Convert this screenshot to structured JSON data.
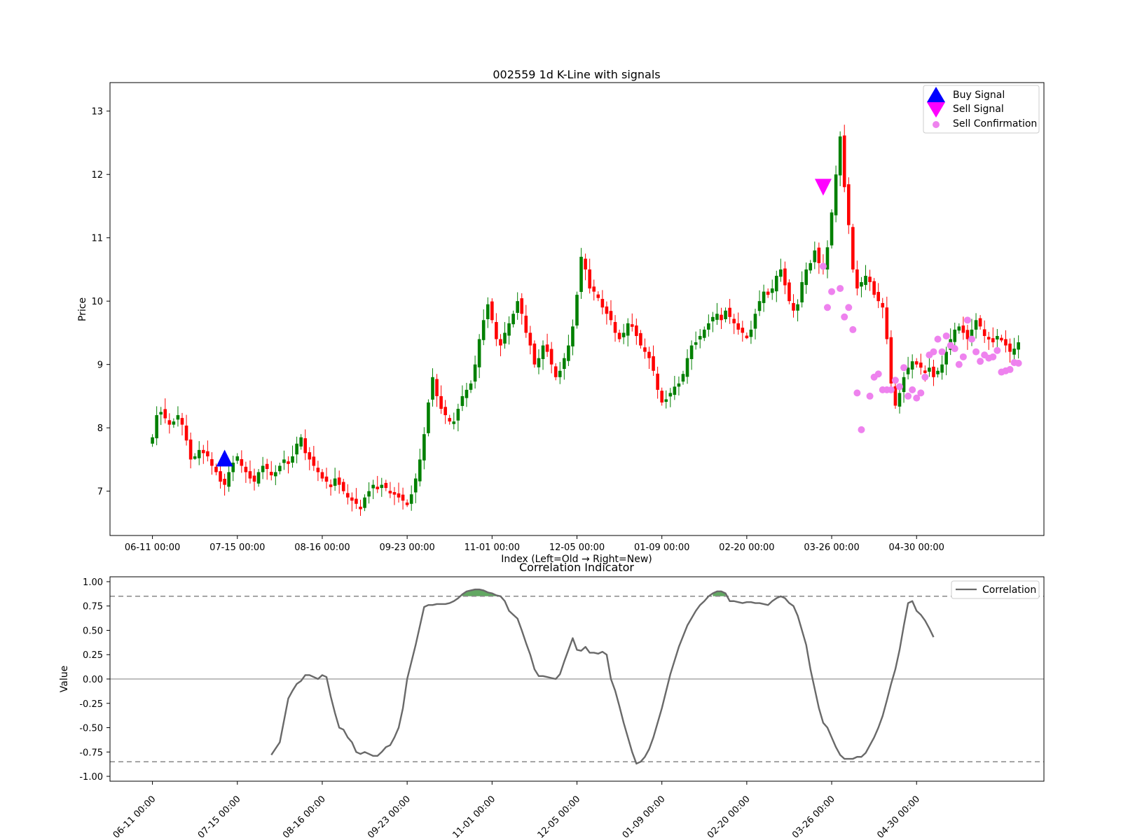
{
  "chart_data": [
    {
      "type": "candlestick",
      "title": "002559 1d K-Line with signals",
      "xlabel": "Index (Left=Old → Right=New)",
      "ylabel": "Price",
      "ylim": [
        6.3,
        13.45
      ],
      "xlim": [
        -10,
        210
      ],
      "x_ticks": [
        {
          "x": 0,
          "label": "06-11 00:00"
        },
        {
          "x": 20,
          "label": "07-15 00:00"
        },
        {
          "x": 40,
          "label": "08-16 00:00"
        },
        {
          "x": 60,
          "label": "09-23 00:00"
        },
        {
          "x": 80,
          "label": "11-01 00:00"
        },
        {
          "x": 100,
          "label": "12-05 00:00"
        },
        {
          "x": 120,
          "label": "01-09 00:00"
        },
        {
          "x": 140,
          "label": "02-20 00:00"
        },
        {
          "x": 160,
          "label": "03-26 00:00"
        },
        {
          "x": 180,
          "label": "04-30 00:00"
        }
      ],
      "y_ticks": [
        7,
        8,
        9,
        10,
        11,
        12,
        13
      ],
      "colors": {
        "up": "#008000",
        "down": "#ff0000",
        "buy": "#0000ff",
        "sell": "#ff00ff",
        "confirm": "#ee82ee"
      },
      "legend": {
        "position": "top-right",
        "entries": [
          {
            "label": "Buy Signal",
            "marker": "triangle-up",
            "color": "#0000ff"
          },
          {
            "label": "Sell Signal",
            "marker": "triangle-down",
            "color": "#ff00ff"
          },
          {
            "label": "Sell Confirmation",
            "marker": "circle",
            "color": "#ee82ee"
          }
        ]
      },
      "closes": [
        7.85,
        8.2,
        8.25,
        8.15,
        8.05,
        8.1,
        8.2,
        8.05,
        7.8,
        7.5,
        7.55,
        7.65,
        7.6,
        7.55,
        7.4,
        7.3,
        7.15,
        7.1,
        7.3,
        7.45,
        7.55,
        7.4,
        7.3,
        7.2,
        7.15,
        7.3,
        7.4,
        7.35,
        7.25,
        7.3,
        7.4,
        7.5,
        7.45,
        7.55,
        7.75,
        7.85,
        7.6,
        7.5,
        7.4,
        7.3,
        7.2,
        7.15,
        7.1,
        7.2,
        7.1,
        7.0,
        6.9,
        6.85,
        6.8,
        6.75,
        6.9,
        7.0,
        7.1,
        7.05,
        7.1,
        7.05,
        7.0,
        6.95,
        6.9,
        6.85,
        6.8,
        6.95,
        7.2,
        7.5,
        7.9,
        8.4,
        8.8,
        8.5,
        8.3,
        8.2,
        8.1,
        8.1,
        8.3,
        8.5,
        8.6,
        8.7,
        9.0,
        9.4,
        9.7,
        9.95,
        9.7,
        9.4,
        9.3,
        9.5,
        9.65,
        9.8,
        10.0,
        9.8,
        9.5,
        9.3,
        9.0,
        9.1,
        9.3,
        9.2,
        9.0,
        8.8,
        8.9,
        9.1,
        9.3,
        9.6,
        10.1,
        10.7,
        10.5,
        10.2,
        10.15,
        10.05,
        9.9,
        9.8,
        9.7,
        9.5,
        9.4,
        9.5,
        9.65,
        9.6,
        9.45,
        9.3,
        9.2,
        9.1,
        8.9,
        8.6,
        8.4,
        8.45,
        8.55,
        8.65,
        8.7,
        8.85,
        9.1,
        9.3,
        9.35,
        9.45,
        9.55,
        9.65,
        9.75,
        9.8,
        9.7,
        9.85,
        9.75,
        9.65,
        9.55,
        9.5,
        9.45,
        9.55,
        9.8,
        10.0,
        10.15,
        10.1,
        10.2,
        10.4,
        10.5,
        10.25,
        10.0,
        9.85,
        9.95,
        10.3,
        10.5,
        10.6,
        10.8,
        10.6,
        10.5,
        10.85,
        11.4,
        12.0,
        12.6,
        11.8,
        11.2,
        10.5,
        10.2,
        10.3,
        10.4,
        10.3,
        10.1,
        10.0,
        9.9,
        9.4,
        8.7,
        8.35,
        8.55,
        8.8,
        8.95,
        9.05,
        9.0,
        8.95,
        8.9,
        8.95,
        8.8,
        8.9,
        9.0,
        9.2,
        9.4,
        9.55,
        9.6,
        9.5,
        9.4,
        9.55,
        9.7,
        9.6,
        9.45,
        9.4,
        9.35,
        9.45,
        9.4,
        9.3,
        9.2,
        9.25,
        9.35
      ],
      "signals": {
        "buy": [
          {
            "x": 17,
            "price": 7.5
          }
        ],
        "sell": [
          {
            "x": 158,
            "price": 11.82
          }
        ],
        "sell_confirmation": [
          {
            "x": 158,
            "price": 10.55
          },
          {
            "x": 159,
            "price": 9.9
          },
          {
            "x": 160,
            "price": 10.15
          },
          {
            "x": 162,
            "price": 10.2
          },
          {
            "x": 163,
            "price": 9.75
          },
          {
            "x": 164,
            "price": 9.9
          },
          {
            "x": 165,
            "price": 9.55
          },
          {
            "x": 166,
            "price": 8.55
          },
          {
            "x": 167,
            "price": 7.97
          },
          {
            "x": 169,
            "price": 8.5
          },
          {
            "x": 170,
            "price": 8.8
          },
          {
            "x": 171,
            "price": 8.85
          },
          {
            "x": 172,
            "price": 8.6
          },
          {
            "x": 173,
            "price": 8.6
          },
          {
            "x": 174,
            "price": 8.6
          },
          {
            "x": 175,
            "price": 8.75
          },
          {
            "x": 176,
            "price": 8.65
          },
          {
            "x": 177,
            "price": 8.95
          },
          {
            "x": 178,
            "price": 8.5
          },
          {
            "x": 179,
            "price": 8.6
          },
          {
            "x": 180,
            "price": 8.47
          },
          {
            "x": 181,
            "price": 8.55
          },
          {
            "x": 182,
            "price": 8.8
          },
          {
            "x": 183,
            "price": 9.15
          },
          {
            "x": 184,
            "price": 9.2
          },
          {
            "x": 185,
            "price": 9.4
          },
          {
            "x": 186,
            "price": 9.2
          },
          {
            "x": 187,
            "price": 9.45
          },
          {
            "x": 188,
            "price": 9.3
          },
          {
            "x": 189,
            "price": 9.25
          },
          {
            "x": 190,
            "price": 9.0
          },
          {
            "x": 191,
            "price": 9.12
          },
          {
            "x": 192,
            "price": 9.7
          },
          {
            "x": 193,
            "price": 9.4
          },
          {
            "x": 194,
            "price": 9.2
          },
          {
            "x": 195,
            "price": 9.05
          },
          {
            "x": 196,
            "price": 9.15
          },
          {
            "x": 197,
            "price": 9.1
          },
          {
            "x": 198,
            "price": 9.12
          },
          {
            "x": 199,
            "price": 9.22
          },
          {
            "x": 200,
            "price": 8.88
          },
          {
            "x": 201,
            "price": 8.9
          },
          {
            "x": 202,
            "price": 8.92
          },
          {
            "x": 203,
            "price": 9.03
          },
          {
            "x": 204,
            "price": 9.02
          }
        ]
      }
    },
    {
      "type": "line",
      "title": "Correlation Indicator",
      "ylabel": "Value",
      "ylim": [
        -1.05,
        1.05
      ],
      "xlim": [
        -10,
        210
      ],
      "y_ticks": [
        "1.00",
        "0.75",
        "0.50",
        "0.25",
        "0.00",
        "-0.25",
        "-0.50",
        "-0.75",
        "-1.00"
      ],
      "x_ticks": [
        {
          "x": 0,
          "label": "06-11 00:00"
        },
        {
          "x": 20,
          "label": "07-15 00:00"
        },
        {
          "x": 40,
          "label": "08-16 00:00"
        },
        {
          "x": 60,
          "label": "09-23 00:00"
        },
        {
          "x": 80,
          "label": "11-01 00:00"
        },
        {
          "x": 100,
          "label": "12-05 00:00"
        },
        {
          "x": 120,
          "label": "01-09 00:00"
        },
        {
          "x": 140,
          "label": "02-20 00:00"
        },
        {
          "x": 160,
          "label": "03-26 00:00"
        },
        {
          "x": 180,
          "label": "04-30 00:00"
        }
      ],
      "thresholds": [
        0.85,
        -0.85
      ],
      "grid": false,
      "legend": {
        "position": "top-right",
        "entries": [
          {
            "label": "Correlation",
            "color": "#696969"
          }
        ]
      },
      "series": [
        {
          "name": "Correlation",
          "color": "#696969",
          "points": [
            [
              28,
              -0.78
            ],
            [
              30,
              -0.65
            ],
            [
              32,
              -0.2
            ],
            [
              33,
              -0.12
            ],
            [
              34,
              -0.05
            ],
            [
              35,
              -0.02
            ],
            [
              36,
              0.04
            ],
            [
              37,
              0.04
            ],
            [
              38,
              0.02
            ],
            [
              39,
              0.0
            ],
            [
              40,
              0.04
            ],
            [
              41,
              0.02
            ],
            [
              42,
              -0.18
            ],
            [
              43,
              -0.35
            ],
            [
              44,
              -0.5
            ],
            [
              45,
              -0.52
            ],
            [
              46,
              -0.6
            ],
            [
              47,
              -0.65
            ],
            [
              48,
              -0.75
            ],
            [
              49,
              -0.77
            ],
            [
              50,
              -0.75
            ],
            [
              51,
              -0.77
            ],
            [
              52,
              -0.79
            ],
            [
              53,
              -0.79
            ],
            [
              54,
              -0.75
            ],
            [
              55,
              -0.7
            ],
            [
              56,
              -0.68
            ],
            [
              57,
              -0.6
            ],
            [
              58,
              -0.5
            ],
            [
              59,
              -0.3
            ],
            [
              60,
              0.0
            ],
            [
              62,
              0.35
            ],
            [
              64,
              0.74
            ],
            [
              65,
              0.76
            ],
            [
              66,
              0.76
            ],
            [
              67,
              0.77
            ],
            [
              68,
              0.77
            ],
            [
              69,
              0.77
            ],
            [
              70,
              0.78
            ],
            [
              71,
              0.8
            ],
            [
              72,
              0.83
            ],
            [
              73,
              0.87
            ],
            [
              74,
              0.9
            ],
            [
              75,
              0.91
            ],
            [
              76,
              0.92
            ],
            [
              77,
              0.92
            ],
            [
              78,
              0.91
            ],
            [
              79,
              0.89
            ],
            [
              80,
              0.88
            ],
            [
              81,
              0.86
            ],
            [
              82,
              0.85
            ],
            [
              83,
              0.8
            ],
            [
              84,
              0.7
            ],
            [
              85,
              0.66
            ],
            [
              86,
              0.62
            ],
            [
              87,
              0.5
            ],
            [
              88,
              0.37
            ],
            [
              89,
              0.25
            ],
            [
              90,
              0.1
            ],
            [
              91,
              0.03
            ],
            [
              92,
              0.03
            ],
            [
              93,
              0.02
            ],
            [
              94,
              0.01
            ],
            [
              95,
              0.0
            ],
            [
              96,
              0.05
            ],
            [
              97,
              0.18
            ],
            [
              98,
              0.3
            ],
            [
              99,
              0.42
            ],
            [
              100,
              0.3
            ],
            [
              101,
              0.29
            ],
            [
              102,
              0.33
            ],
            [
              103,
              0.27
            ],
            [
              104,
              0.27
            ],
            [
              105,
              0.26
            ],
            [
              106,
              0.28
            ],
            [
              107,
              0.25
            ],
            [
              108,
              0.0
            ],
            [
              109,
              -0.12
            ],
            [
              110,
              -0.28
            ],
            [
              111,
              -0.45
            ],
            [
              112,
              -0.6
            ],
            [
              113,
              -0.75
            ],
            [
              114,
              -0.87
            ],
            [
              115,
              -0.85
            ],
            [
              116,
              -0.8
            ],
            [
              117,
              -0.72
            ],
            [
              118,
              -0.6
            ],
            [
              120,
              -0.3
            ],
            [
              122,
              0.05
            ],
            [
              124,
              0.33
            ],
            [
              126,
              0.55
            ],
            [
              128,
              0.7
            ],
            [
              129,
              0.76
            ],
            [
              130,
              0.8
            ],
            [
              131,
              0.85
            ],
            [
              132,
              0.88
            ],
            [
              133,
              0.9
            ],
            [
              134,
              0.9
            ],
            [
              135,
              0.88
            ],
            [
              136,
              0.8
            ],
            [
              137,
              0.8
            ],
            [
              138,
              0.79
            ],
            [
              139,
              0.78
            ],
            [
              140,
              0.79
            ],
            [
              141,
              0.79
            ],
            [
              142,
              0.78
            ],
            [
              143,
              0.78
            ],
            [
              144,
              0.77
            ],
            [
              145,
              0.76
            ],
            [
              146,
              0.8
            ],
            [
              147,
              0.83
            ],
            [
              148,
              0.85
            ],
            [
              149,
              0.83
            ],
            [
              150,
              0.78
            ],
            [
              151,
              0.75
            ],
            [
              152,
              0.65
            ],
            [
              153,
              0.5
            ],
            [
              154,
              0.35
            ],
            [
              155,
              0.1
            ],
            [
              156,
              -0.1
            ],
            [
              157,
              -0.3
            ],
            [
              158,
              -0.45
            ],
            [
              159,
              -0.5
            ],
            [
              160,
              -0.6
            ],
            [
              161,
              -0.7
            ],
            [
              162,
              -0.78
            ],
            [
              163,
              -0.82
            ],
            [
              164,
              -0.82
            ],
            [
              165,
              -0.82
            ],
            [
              166,
              -0.8
            ],
            [
              167,
              -0.8
            ],
            [
              168,
              -0.76
            ],
            [
              169,
              -0.68
            ],
            [
              170,
              -0.6
            ],
            [
              171,
              -0.5
            ],
            [
              172,
              -0.38
            ],
            [
              173,
              -0.22
            ],
            [
              174,
              -0.05
            ],
            [
              175,
              0.1
            ],
            [
              176,
              0.3
            ],
            [
              177,
              0.55
            ],
            [
              178,
              0.78
            ],
            [
              179,
              0.8
            ],
            [
              180,
              0.7
            ],
            [
              181,
              0.66
            ],
            [
              182,
              0.6
            ],
            [
              183,
              0.52
            ],
            [
              184,
              0.43
            ]
          ]
        }
      ]
    }
  ]
}
